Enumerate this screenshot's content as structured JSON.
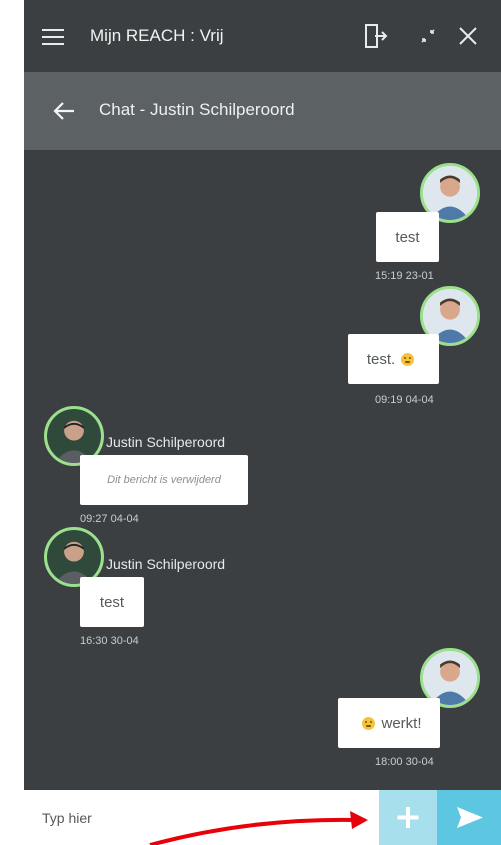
{
  "header": {
    "title": "Mijn REACH : Vrij"
  },
  "subheader": {
    "title": "Chat - Justin Schilperoord"
  },
  "messages": [
    {
      "text": "test",
      "time": "15:19 23-01"
    },
    {
      "text": "test.",
      "time": "09:19 04-04"
    },
    {
      "sender": "Justin Schilperoord",
      "text": "Dit bericht is verwijderd",
      "time": "09:27 04-04"
    },
    {
      "sender": "Justin Schilperoord",
      "text": "test",
      "time": "16:30 30-04"
    },
    {
      "text": "werkt!",
      "time": "18:00 30-04"
    }
  ],
  "composer": {
    "placeholder": "Typ hier"
  },
  "colors": {
    "background": "#3b3f41",
    "subheader": "#5c6164",
    "avatar_border": "#9be08b",
    "add_button": "#a7dfec",
    "send_button": "#5dc6e0",
    "annotation_arrow": "#e8000b"
  }
}
